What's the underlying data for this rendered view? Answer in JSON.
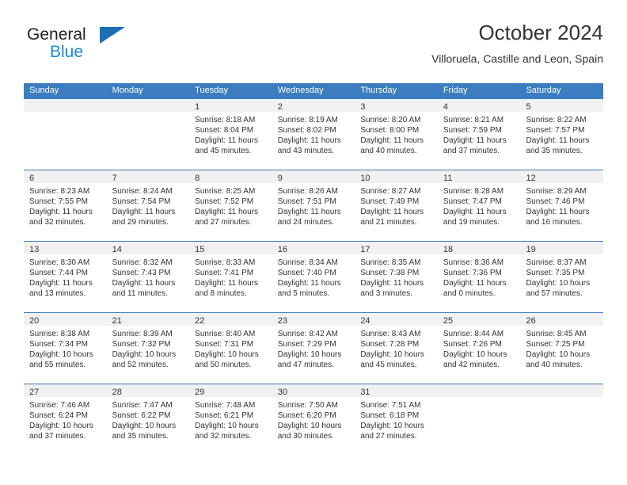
{
  "brand": {
    "name_part1": "General",
    "name_part2": "Blue",
    "triangle_color": "#1c6fb5",
    "blue_color": "#1c89d8"
  },
  "header": {
    "title": "October 2024",
    "subtitle": "Villoruela, Castille and Leon, Spain"
  },
  "theme": {
    "header_blue": "#3b7dbf",
    "daynum_band": "#f1f1f1",
    "text": "#333333"
  },
  "calendar": {
    "weekday_headers": [
      "Sunday",
      "Monday",
      "Tuesday",
      "Wednesday",
      "Thursday",
      "Friday",
      "Saturday"
    ],
    "weeks": [
      [
        {
          "day": "",
          "sunrise": "",
          "sunset": "",
          "daylight_line1": "",
          "daylight_line2": ""
        },
        {
          "day": "",
          "sunrise": "",
          "sunset": "",
          "daylight_line1": "",
          "daylight_line2": ""
        },
        {
          "day": "1",
          "sunrise": "Sunrise: 8:18 AM",
          "sunset": "Sunset: 8:04 PM",
          "daylight_line1": "Daylight: 11 hours",
          "daylight_line2": "and 45 minutes."
        },
        {
          "day": "2",
          "sunrise": "Sunrise: 8:19 AM",
          "sunset": "Sunset: 8:02 PM",
          "daylight_line1": "Daylight: 11 hours",
          "daylight_line2": "and 43 minutes."
        },
        {
          "day": "3",
          "sunrise": "Sunrise: 8:20 AM",
          "sunset": "Sunset: 8:00 PM",
          "daylight_line1": "Daylight: 11 hours",
          "daylight_line2": "and 40 minutes."
        },
        {
          "day": "4",
          "sunrise": "Sunrise: 8:21 AM",
          "sunset": "Sunset: 7:59 PM",
          "daylight_line1": "Daylight: 11 hours",
          "daylight_line2": "and 37 minutes."
        },
        {
          "day": "5",
          "sunrise": "Sunrise: 8:22 AM",
          "sunset": "Sunset: 7:57 PM",
          "daylight_line1": "Daylight: 11 hours",
          "daylight_line2": "and 35 minutes."
        }
      ],
      [
        {
          "day": "6",
          "sunrise": "Sunrise: 8:23 AM",
          "sunset": "Sunset: 7:55 PM",
          "daylight_line1": "Daylight: 11 hours",
          "daylight_line2": "and 32 minutes."
        },
        {
          "day": "7",
          "sunrise": "Sunrise: 8:24 AM",
          "sunset": "Sunset: 7:54 PM",
          "daylight_line1": "Daylight: 11 hours",
          "daylight_line2": "and 29 minutes."
        },
        {
          "day": "8",
          "sunrise": "Sunrise: 8:25 AM",
          "sunset": "Sunset: 7:52 PM",
          "daylight_line1": "Daylight: 11 hours",
          "daylight_line2": "and 27 minutes."
        },
        {
          "day": "9",
          "sunrise": "Sunrise: 8:26 AM",
          "sunset": "Sunset: 7:51 PM",
          "daylight_line1": "Daylight: 11 hours",
          "daylight_line2": "and 24 minutes."
        },
        {
          "day": "10",
          "sunrise": "Sunrise: 8:27 AM",
          "sunset": "Sunset: 7:49 PM",
          "daylight_line1": "Daylight: 11 hours",
          "daylight_line2": "and 21 minutes."
        },
        {
          "day": "11",
          "sunrise": "Sunrise: 8:28 AM",
          "sunset": "Sunset: 7:47 PM",
          "daylight_line1": "Daylight: 11 hours",
          "daylight_line2": "and 19 minutes."
        },
        {
          "day": "12",
          "sunrise": "Sunrise: 8:29 AM",
          "sunset": "Sunset: 7:46 PM",
          "daylight_line1": "Daylight: 11 hours",
          "daylight_line2": "and 16 minutes."
        }
      ],
      [
        {
          "day": "13",
          "sunrise": "Sunrise: 8:30 AM",
          "sunset": "Sunset: 7:44 PM",
          "daylight_line1": "Daylight: 11 hours",
          "daylight_line2": "and 13 minutes."
        },
        {
          "day": "14",
          "sunrise": "Sunrise: 8:32 AM",
          "sunset": "Sunset: 7:43 PM",
          "daylight_line1": "Daylight: 11 hours",
          "daylight_line2": "and 11 minutes."
        },
        {
          "day": "15",
          "sunrise": "Sunrise: 8:33 AM",
          "sunset": "Sunset: 7:41 PM",
          "daylight_line1": "Daylight: 11 hours",
          "daylight_line2": "and 8 minutes."
        },
        {
          "day": "16",
          "sunrise": "Sunrise: 8:34 AM",
          "sunset": "Sunset: 7:40 PM",
          "daylight_line1": "Daylight: 11 hours",
          "daylight_line2": "and 5 minutes."
        },
        {
          "day": "17",
          "sunrise": "Sunrise: 8:35 AM",
          "sunset": "Sunset: 7:38 PM",
          "daylight_line1": "Daylight: 11 hours",
          "daylight_line2": "and 3 minutes."
        },
        {
          "day": "18",
          "sunrise": "Sunrise: 8:36 AM",
          "sunset": "Sunset: 7:36 PM",
          "daylight_line1": "Daylight: 11 hours",
          "daylight_line2": "and 0 minutes."
        },
        {
          "day": "19",
          "sunrise": "Sunrise: 8:37 AM",
          "sunset": "Sunset: 7:35 PM",
          "daylight_line1": "Daylight: 10 hours",
          "daylight_line2": "and 57 minutes."
        }
      ],
      [
        {
          "day": "20",
          "sunrise": "Sunrise: 8:38 AM",
          "sunset": "Sunset: 7:34 PM",
          "daylight_line1": "Daylight: 10 hours",
          "daylight_line2": "and 55 minutes."
        },
        {
          "day": "21",
          "sunrise": "Sunrise: 8:39 AM",
          "sunset": "Sunset: 7:32 PM",
          "daylight_line1": "Daylight: 10 hours",
          "daylight_line2": "and 52 minutes."
        },
        {
          "day": "22",
          "sunrise": "Sunrise: 8:40 AM",
          "sunset": "Sunset: 7:31 PM",
          "daylight_line1": "Daylight: 10 hours",
          "daylight_line2": "and 50 minutes."
        },
        {
          "day": "23",
          "sunrise": "Sunrise: 8:42 AM",
          "sunset": "Sunset: 7:29 PM",
          "daylight_line1": "Daylight: 10 hours",
          "daylight_line2": "and 47 minutes."
        },
        {
          "day": "24",
          "sunrise": "Sunrise: 8:43 AM",
          "sunset": "Sunset: 7:28 PM",
          "daylight_line1": "Daylight: 10 hours",
          "daylight_line2": "and 45 minutes."
        },
        {
          "day": "25",
          "sunrise": "Sunrise: 8:44 AM",
          "sunset": "Sunset: 7:26 PM",
          "daylight_line1": "Daylight: 10 hours",
          "daylight_line2": "and 42 minutes."
        },
        {
          "day": "26",
          "sunrise": "Sunrise: 8:45 AM",
          "sunset": "Sunset: 7:25 PM",
          "daylight_line1": "Daylight: 10 hours",
          "daylight_line2": "and 40 minutes."
        }
      ],
      [
        {
          "day": "27",
          "sunrise": "Sunrise: 7:46 AM",
          "sunset": "Sunset: 6:24 PM",
          "daylight_line1": "Daylight: 10 hours",
          "daylight_line2": "and 37 minutes."
        },
        {
          "day": "28",
          "sunrise": "Sunrise: 7:47 AM",
          "sunset": "Sunset: 6:22 PM",
          "daylight_line1": "Daylight: 10 hours",
          "daylight_line2": "and 35 minutes."
        },
        {
          "day": "29",
          "sunrise": "Sunrise: 7:48 AM",
          "sunset": "Sunset: 6:21 PM",
          "daylight_line1": "Daylight: 10 hours",
          "daylight_line2": "and 32 minutes."
        },
        {
          "day": "30",
          "sunrise": "Sunrise: 7:50 AM",
          "sunset": "Sunset: 6:20 PM",
          "daylight_line1": "Daylight: 10 hours",
          "daylight_line2": "and 30 minutes."
        },
        {
          "day": "31",
          "sunrise": "Sunrise: 7:51 AM",
          "sunset": "Sunset: 6:18 PM",
          "daylight_line1": "Daylight: 10 hours",
          "daylight_line2": "and 27 minutes."
        },
        {
          "day": "",
          "sunrise": "",
          "sunset": "",
          "daylight_line1": "",
          "daylight_line2": ""
        },
        {
          "day": "",
          "sunrise": "",
          "sunset": "",
          "daylight_line1": "",
          "daylight_line2": ""
        }
      ]
    ]
  }
}
